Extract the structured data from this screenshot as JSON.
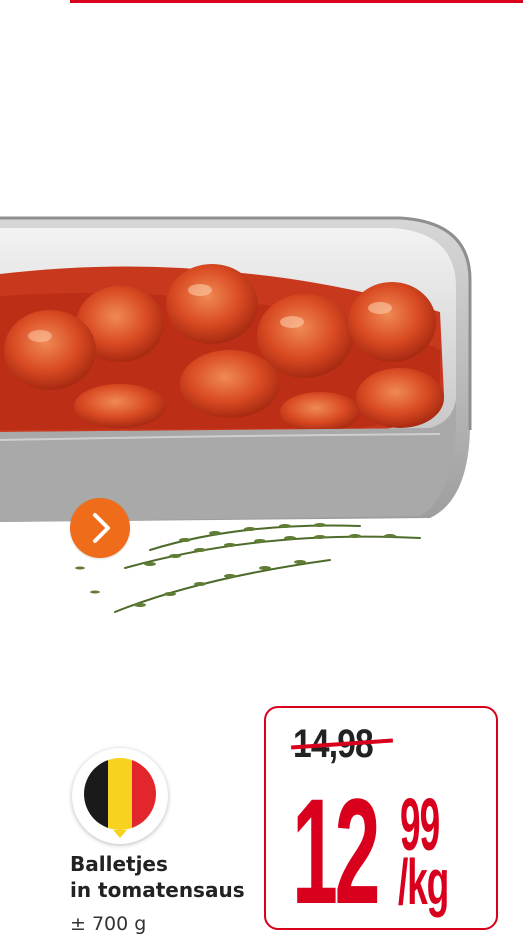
{
  "product": {
    "name_line1": "Balletjes",
    "name_line2": "in tomatensaus",
    "weight": "± 700 g",
    "origin_flag_icon": "belgium-flag-icon"
  },
  "price": {
    "old": "14,98",
    "main": "12",
    "cents": "99",
    "unit": "/kg"
  },
  "icons": {
    "next": "chevron-right-icon"
  },
  "colors": {
    "brand_red": "#d8001c",
    "accent_orange": "#ef6c1a",
    "flag_black": "#1a1a1a",
    "flag_yellow": "#f7d21f",
    "flag_red": "#e1262c"
  }
}
